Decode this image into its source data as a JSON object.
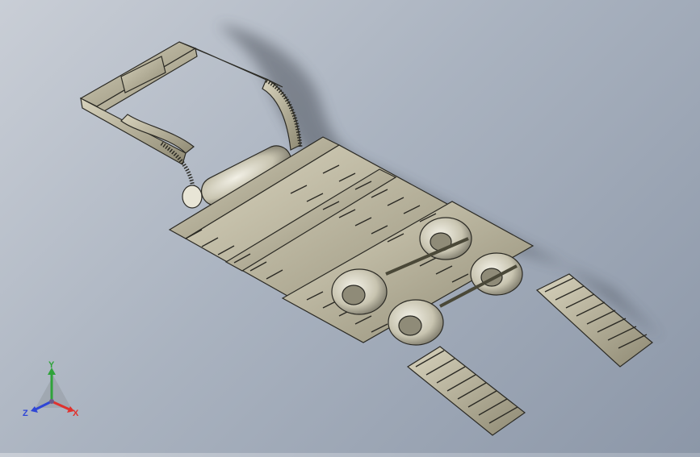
{
  "viewport": {
    "background_top": "#c9ced6",
    "background_bottom": "#8c97a8",
    "model_color": "#b9b49c",
    "model_edge": "#2b2a24"
  },
  "triad": {
    "x_label": "X",
    "y_label": "Y",
    "z_label": "Z",
    "x_color": "#e0322e",
    "y_color": "#2fa33a",
    "z_color": "#2f46d6"
  }
}
